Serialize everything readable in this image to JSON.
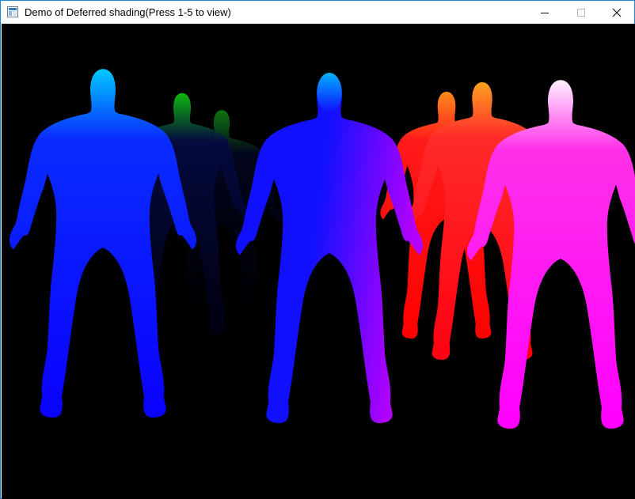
{
  "window": {
    "title": "Demo of Deferred shading(Press 1-5 to view)",
    "border_color": "#1883d7"
  },
  "title_controls": {
    "minimize_icon": "minimize-icon",
    "maximize_icon": "maximize-icon",
    "close_icon": "close-icon"
  },
  "scene": {
    "background_color": "#000000",
    "figures": [
      {
        "name": "figure-front-left",
        "colors": [
          "#00c8ff",
          "#0a2cff",
          "#0a00ff"
        ]
      },
      {
        "name": "figure-back-left-green",
        "colors": [
          "#10c010",
          "#050a40",
          "#000010"
        ]
      },
      {
        "name": "figure-back-left-dark",
        "colors": [
          "#128812",
          "#020520",
          "#000000"
        ]
      },
      {
        "name": "figure-front-center",
        "colors": [
          "#00b0ff",
          "#1010ff",
          "#b400ff"
        ]
      },
      {
        "name": "figure-back-right-orange",
        "colors": [
          "#ff8a1c",
          "#ff1a1a",
          "#ff0000"
        ]
      },
      {
        "name": "figure-back-right-red",
        "colors": [
          "#ffa020",
          "#ff2a2a",
          "#ff0010"
        ]
      },
      {
        "name": "figure-front-right",
        "colors": [
          "#fff0ff",
          "#ff30e8",
          "#ff00ff"
        ]
      }
    ]
  }
}
